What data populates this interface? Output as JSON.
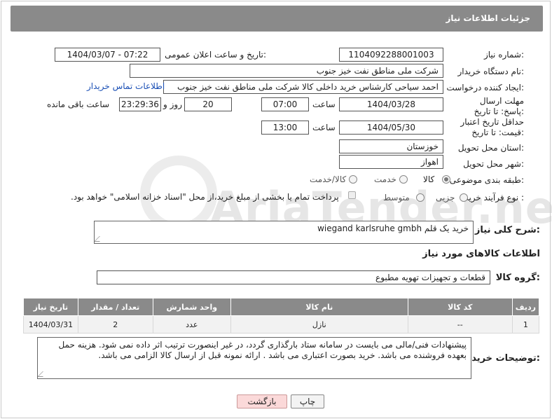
{
  "header": {
    "title": "جزئیات اطلاعات نیاز"
  },
  "fields": {
    "need_number_label": "شماره نیاز:",
    "need_number": "1104092288001003",
    "announce_label": "تاریخ و ساعت اعلان عمومی:",
    "announce_value": "1404/03/07 - 07:22",
    "buyer_org_label": "نام دستگاه خریدار:",
    "buyer_org": "شرکت ملی مناطق نفت خیز جنوب",
    "creator_label": "ایجاد کننده درخواست:",
    "creator": "احمد  سیاحی  کارشناس خرید داخلی کالا شرکت ملی مناطق نفت خیز جنوب",
    "contact_link": "اطلاعات تماس خریدار",
    "reply_deadline_label": "مهلت ارسال پاسخ: تا تاریخ:",
    "reply_date": "1404/03/28",
    "time_label": "ساعت",
    "reply_time": "07:00",
    "days_value": "20",
    "days_label": "روز و",
    "remaining_time": "23:29:36",
    "remaining_label": "ساعت باقی مانده",
    "price_validity_label": "حداقل تاریخ اعتبار قیمت: تا تاریخ:",
    "price_date": "1404/05/30",
    "price_time": "13:00",
    "province_label": "استان محل تحویل:",
    "province": "خوزستان",
    "city_label": "شهر محل تحویل:",
    "city": "اهواز",
    "category_label": "طبقه بندی موضوعی:",
    "category_options": [
      "کالا",
      "خدمت",
      "کالا/خدمت"
    ],
    "process_label": "نوع فرآیند خرید :",
    "process_options": [
      "جزیی",
      "متوسط"
    ],
    "payment_note": "پرداخت تمام یا بخشی از مبلغ خرید،از محل \"اسناد خزانه اسلامی\" خواهد بود."
  },
  "description": {
    "label": "شرح کلی نیاز:",
    "value": "خرید یک قلم wiegand karlsruhe gmbh"
  },
  "goods_info_title": "اطلاعات کالاهای مورد نیاز",
  "goods_group": {
    "label": "گروه کالا:",
    "value": "قطعات و تجهیزات تهویه مطبوع"
  },
  "table": {
    "headers": [
      "ردیف",
      "کد کالا",
      "نام کالا",
      "واحد شمارش",
      "تعداد / مقدار",
      "تاریخ نیاز"
    ],
    "rows": [
      [
        "1",
        "--",
        "نازل",
        "عدد",
        "2",
        "1404/03/31"
      ]
    ]
  },
  "buyer_notes": {
    "label": "توضیحات خریدار:",
    "value": "پیشنهادات فنی/مالی می بایست در سامانه ستاد بارگذاری گردد، در غیر اینصورت ترتیب اثر داده نمی شود. هزینه حمل بعهده فروشنده می باشد. خرید بصورت اعتباری می باشد . ارائه نمونه قبل از ارسال کالا الزامی می باشد."
  },
  "buttons": {
    "print": "چاپ",
    "back": "بازگشت"
  },
  "watermark": "AriaTender.net"
}
